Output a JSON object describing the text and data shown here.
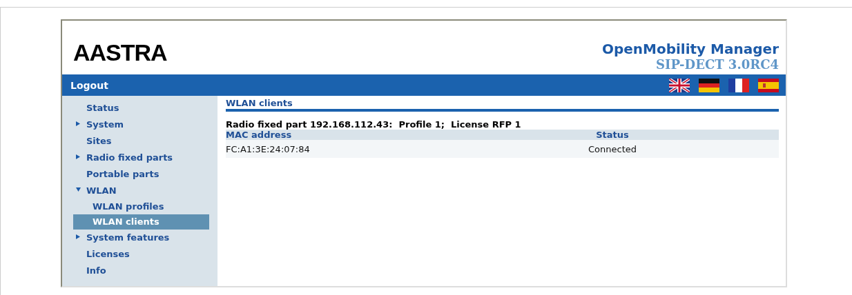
{
  "header": {
    "logo": "AASTRA",
    "product": "OpenMobility Manager",
    "version": "SIP-DECT 3.0RC4"
  },
  "nav_bar": {
    "logout": "Logout"
  },
  "sidebar": {
    "items": [
      {
        "label": "Status",
        "selected": false
      },
      {
        "label": "System",
        "selected": false,
        "expanded": false
      },
      {
        "label": "Sites",
        "selected": false
      },
      {
        "label": "Radio fixed parts",
        "selected": false,
        "expanded": false
      },
      {
        "label": "Portable parts",
        "selected": false
      },
      {
        "label": "WLAN",
        "selected": false,
        "expanded": true,
        "children": [
          {
            "label": "WLAN profiles",
            "selected": false
          },
          {
            "label": "WLAN clients",
            "selected": true
          }
        ]
      },
      {
        "label": "System features",
        "selected": false,
        "expanded": false
      },
      {
        "label": "Licenses",
        "selected": false
      },
      {
        "label": "Info",
        "selected": false
      }
    ]
  },
  "content": {
    "title": "WLAN clients",
    "subtitle": "Radio fixed part 192.168.112.43:  Profile 1;  License RFP 1",
    "table": {
      "columns": [
        "MAC address",
        "Status"
      ],
      "rows": [
        [
          "FC:A1:3E:24:07:84",
          "Connected"
        ]
      ]
    }
  }
}
